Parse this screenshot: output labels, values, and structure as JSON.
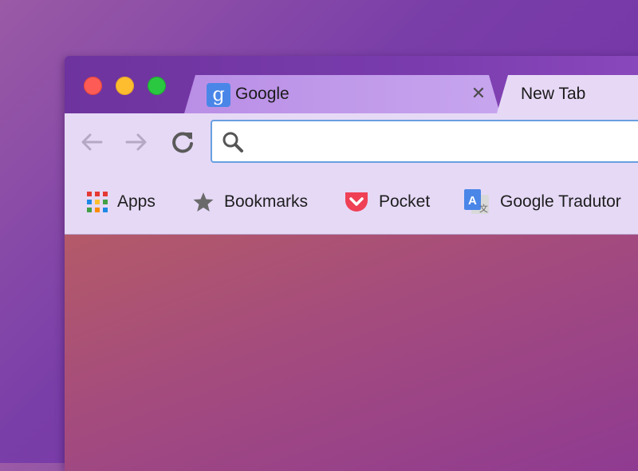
{
  "window": {
    "traffic_lights": {
      "close_color": "#fd5b55",
      "minimize_color": "#fdbd2e",
      "maximize_color": "#2ac741"
    }
  },
  "tabs": [
    {
      "title": "Google",
      "favicon": "google-g-icon",
      "favicon_glyph": "g",
      "active": true,
      "close_glyph": "✕"
    },
    {
      "title": "New Tab",
      "active": false
    }
  ],
  "toolbar": {
    "back_icon": "back-arrow-icon",
    "forward_icon": "forward-arrow-icon",
    "reload_icon": "reload-icon",
    "omnibox": {
      "value": "",
      "placeholder": "",
      "icon": "search-icon"
    }
  },
  "bookmarks": [
    {
      "label": "Apps",
      "icon": "apps-grid-icon"
    },
    {
      "label": "Bookmarks",
      "icon": "star-icon"
    },
    {
      "label": "Pocket",
      "icon": "pocket-icon"
    },
    {
      "label": "Google Tradutor",
      "icon": "google-translate-icon"
    }
  ],
  "colors": {
    "accent_focus": "#6a9fe0",
    "bar_background": "#e6d9f6"
  }
}
